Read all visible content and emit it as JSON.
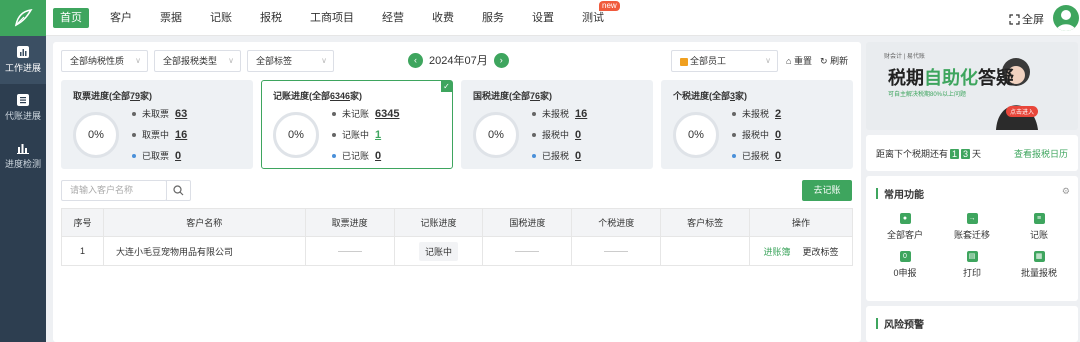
{
  "nav": {
    "items": [
      "首页",
      "客户",
      "票据",
      "记账",
      "报税",
      "工商项目",
      "经营",
      "收费",
      "服务",
      "设置",
      "测试"
    ],
    "new_badge": "new",
    "fullscreen": "全屏"
  },
  "sidebar": {
    "items": [
      {
        "label": "工作进展",
        "icon": "bar-chart-icon"
      },
      {
        "label": "代账进展",
        "icon": "ledger-icon"
      },
      {
        "label": "进度检测",
        "icon": "chart-icon"
      }
    ]
  },
  "filters": {
    "tax_nature": "全部纳税性质",
    "tax_type": "全部报税类型",
    "tag": "全部标签",
    "month": "2024年07月",
    "staff": "全部员工",
    "reset": "重置",
    "refresh": "刷新"
  },
  "cards": [
    {
      "title_prefix": "取票进度(全部",
      "count": "79",
      "suffix": "家)",
      "pct": "0%",
      "stats": [
        {
          "label": "未取票",
          "value": "63"
        },
        {
          "label": "取票中",
          "value": "16"
        },
        {
          "label": "已取票",
          "value": "0"
        }
      ]
    },
    {
      "title_prefix": "记账进度(全部",
      "count": "6346",
      "suffix": "家)",
      "pct": "0%",
      "stats": [
        {
          "label": "未记账",
          "value": "6345"
        },
        {
          "label": "记账中",
          "value": "1"
        },
        {
          "label": "已记账",
          "value": "0"
        }
      ]
    },
    {
      "title_prefix": "国税进度(全部",
      "count": "76",
      "suffix": "家)",
      "pct": "0%",
      "stats": [
        {
          "label": "未报税",
          "value": "16"
        },
        {
          "label": "报税中",
          "value": "0"
        },
        {
          "label": "已报税",
          "value": "0"
        }
      ]
    },
    {
      "title_prefix": "个税进度(全部",
      "count": "3",
      "suffix": "家)",
      "pct": "0%",
      "stats": [
        {
          "label": "未报税",
          "value": "2"
        },
        {
          "label": "报税中",
          "value": "0"
        },
        {
          "label": "已报税",
          "value": "0"
        }
      ]
    }
  ],
  "search": {
    "placeholder": "请输入客户名称"
  },
  "go_button": "去记账",
  "table": {
    "headers": [
      "序号",
      "客户名称",
      "取票进度",
      "记账进度",
      "国税进度",
      "个税进度",
      "客户标签",
      "操作"
    ],
    "rows": [
      {
        "index": "1",
        "name": "大连小毛豆宠物用品有限公司",
        "bookkeeping": "记账中",
        "action1": "进账簿",
        "action2": "更改标签"
      }
    ]
  },
  "banner": {
    "small": "财会计 | 易代账",
    "title_a": "税期",
    "title_b": "自助化",
    "title_c": "答疑",
    "sub": "可自主解决税期80%以上问题",
    "cta": "点击进入"
  },
  "countdown": {
    "prefix": "距离下个税期还有",
    "d1": "1",
    "d2": "3",
    "suffix": "天",
    "link": "查看报税日历"
  },
  "common": {
    "title": "常用功能",
    "items": [
      "全部客户",
      "账套迁移",
      "记账",
      "0申报",
      "打印",
      "批量报税"
    ]
  },
  "risk": {
    "title": "风险预警"
  },
  "colors": {
    "brand": "#3ea55e",
    "sidebar": "#2d3e50"
  }
}
